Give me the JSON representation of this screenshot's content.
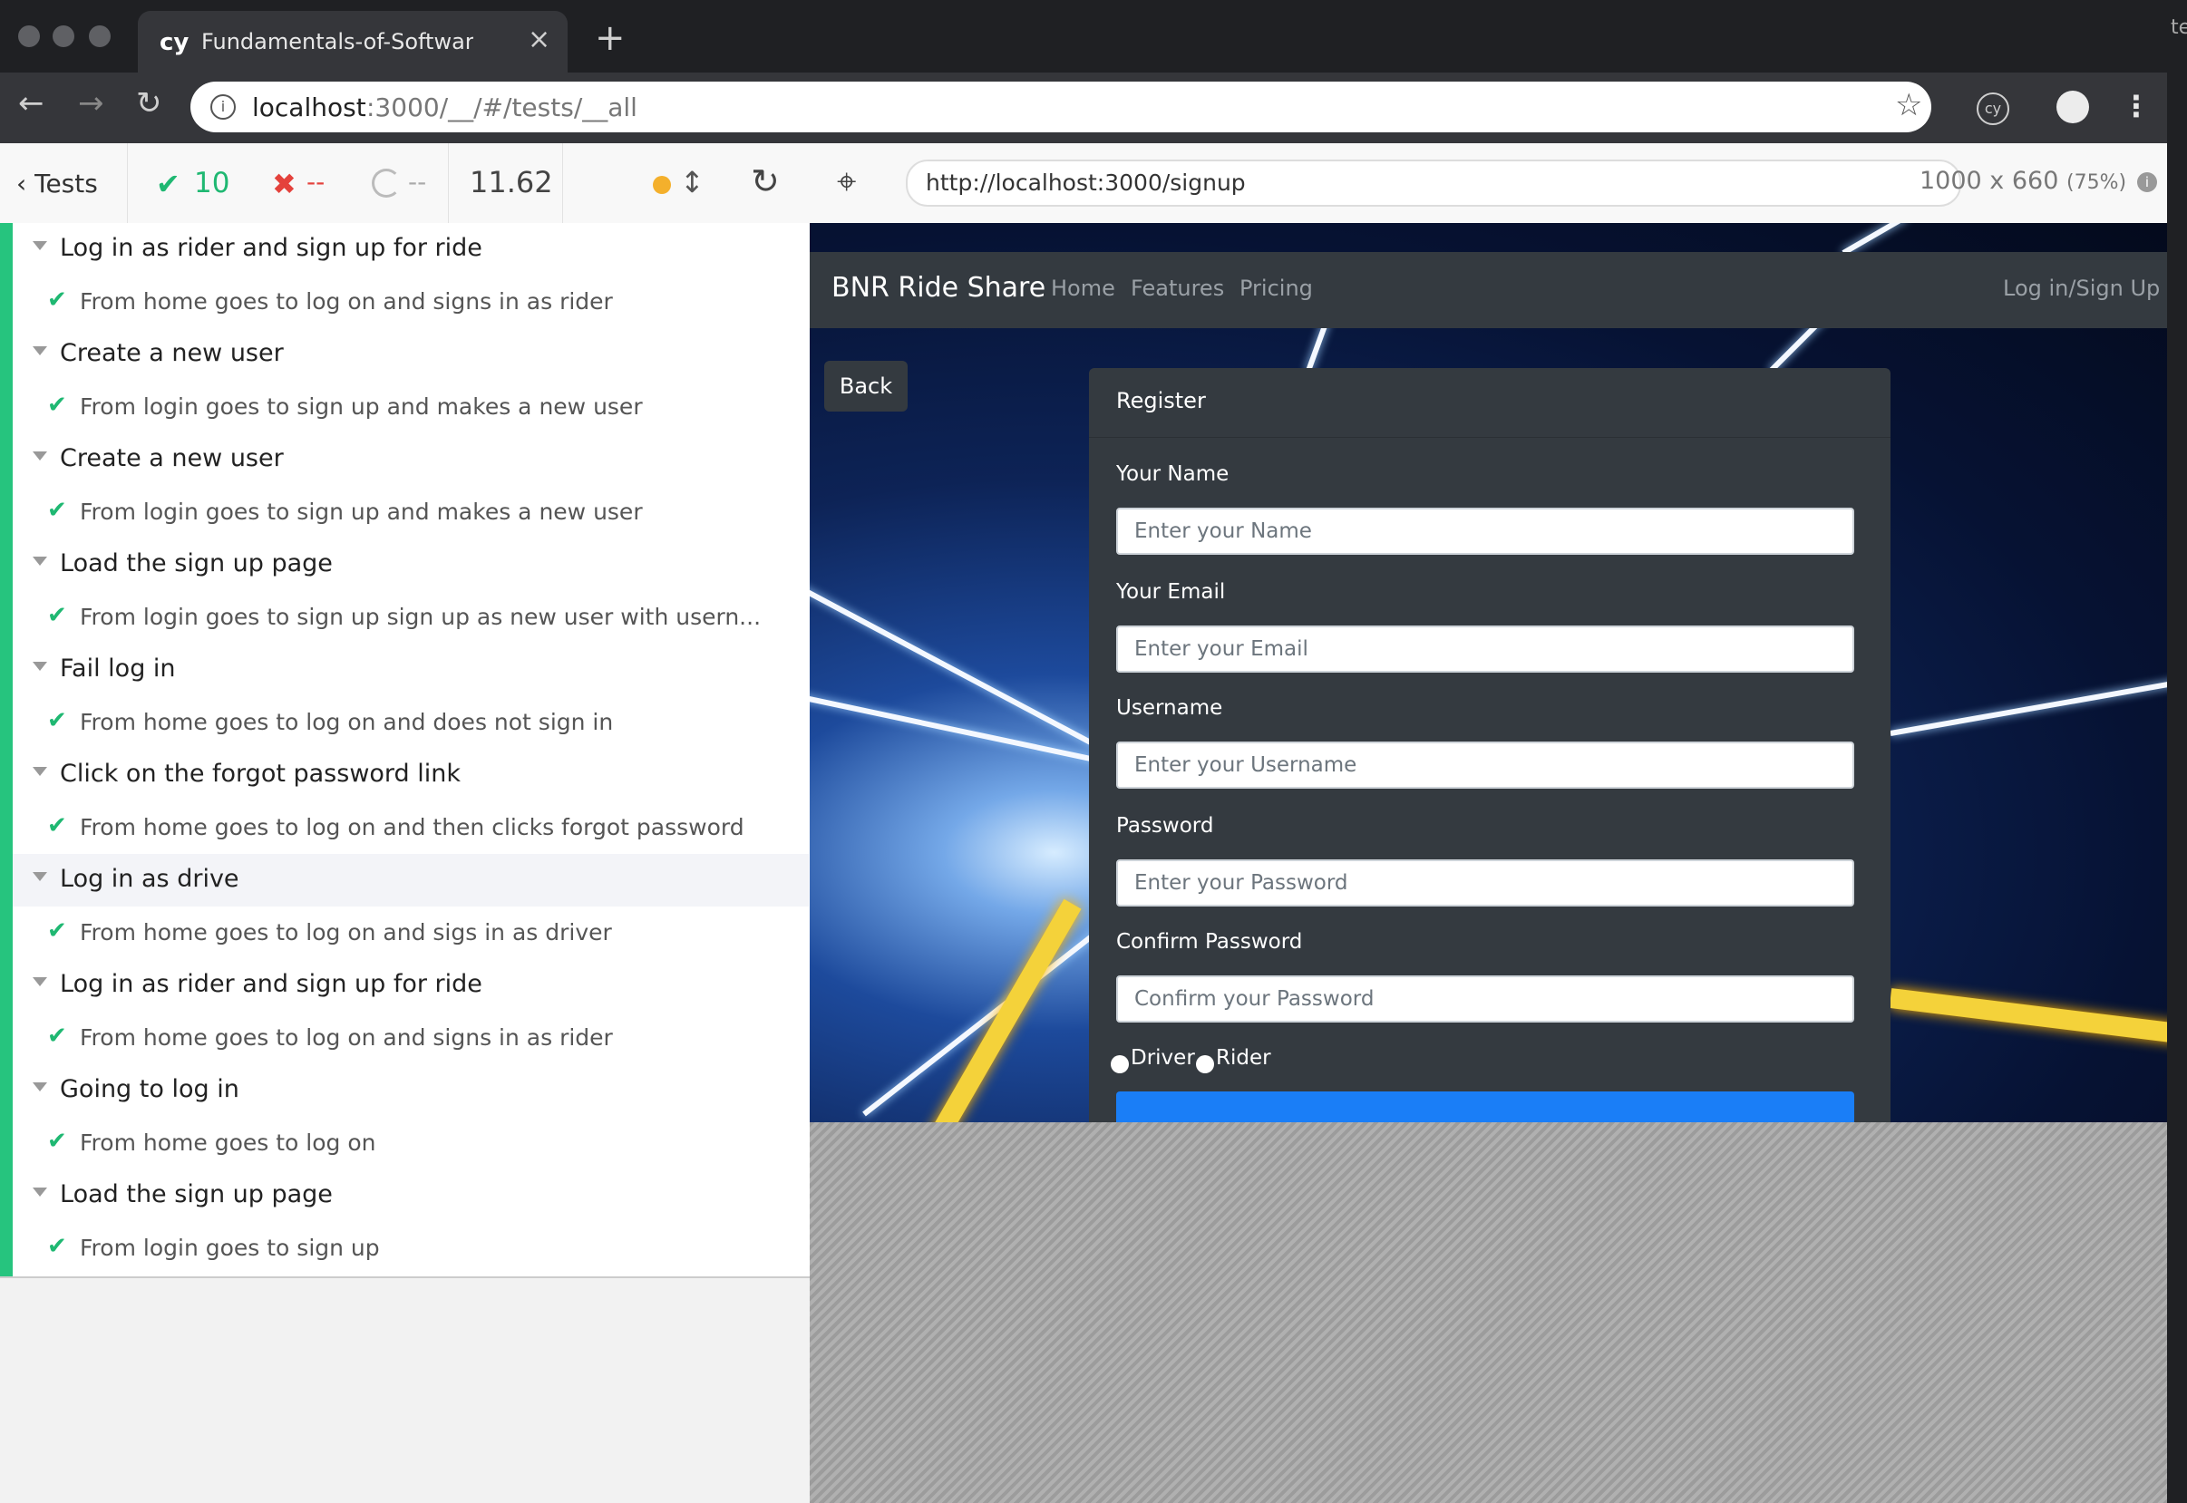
{
  "browser": {
    "tab_icon": "cy",
    "tab_title": "Fundamentals-of-Software-Engineering",
    "tab_close": "×",
    "new_tab": "+",
    "url_host": "localhost",
    "url_path": ":3000/__/#/tests/__all",
    "right_edge_text": "te",
    "extension_label": "cy"
  },
  "runner": {
    "back_label": "Tests",
    "passed": "10",
    "failed": "--",
    "pending": "--",
    "duration": "11.62",
    "aut_url": "http://localhost:3000/signup",
    "viewport": "1000 x 660",
    "scale": "(75%)"
  },
  "suites": [
    {
      "title": "Log in as rider and sign up for ride",
      "test": "From home goes to log on and signs in as rider"
    },
    {
      "title": "Create a new user",
      "test": "From login goes to sign up and makes a new user"
    },
    {
      "title": "Create a new user",
      "test": "From login goes to sign up and makes a new user"
    },
    {
      "title": "Load the sign up page",
      "test": "From login goes to sign up sign up as new user with usern..."
    },
    {
      "title": "Fail log in",
      "test": "From home goes to log on and does not sign in"
    },
    {
      "title": "Click on the forgot password link",
      "test": "From home goes to log on and then clicks forgot password"
    },
    {
      "title": "Log in as drive",
      "test": "From home goes to log on and sigs in as driver"
    },
    {
      "title": "Log in as rider and sign up for ride",
      "test": "From home goes to log on and signs in as rider"
    },
    {
      "title": "Going to log in",
      "test": "From home goes to log on"
    },
    {
      "title": "Load the sign up page",
      "test": "From login goes to sign up"
    }
  ],
  "app": {
    "brand": "BNR Ride Share",
    "nav": [
      "Home",
      "Features",
      "Pricing"
    ],
    "login": "Log in/Sign Up",
    "back": "Back",
    "card_title": "Register",
    "fields": [
      {
        "label": "Your Name",
        "placeholder": "Enter your Name"
      },
      {
        "label": "Your Email",
        "placeholder": "Enter your Email"
      },
      {
        "label": "Username",
        "placeholder": "Enter your Username"
      },
      {
        "label": "Password",
        "placeholder": "Enter your Password"
      },
      {
        "label": "Confirm Password",
        "placeholder": "Confirm your Password"
      }
    ],
    "roles": [
      "Driver",
      "Rider"
    ]
  },
  "colors": {
    "pass": "#1fb872",
    "fail": "#e4423c",
    "navbar": "#343a40",
    "submit": "#1a7ef7"
  }
}
